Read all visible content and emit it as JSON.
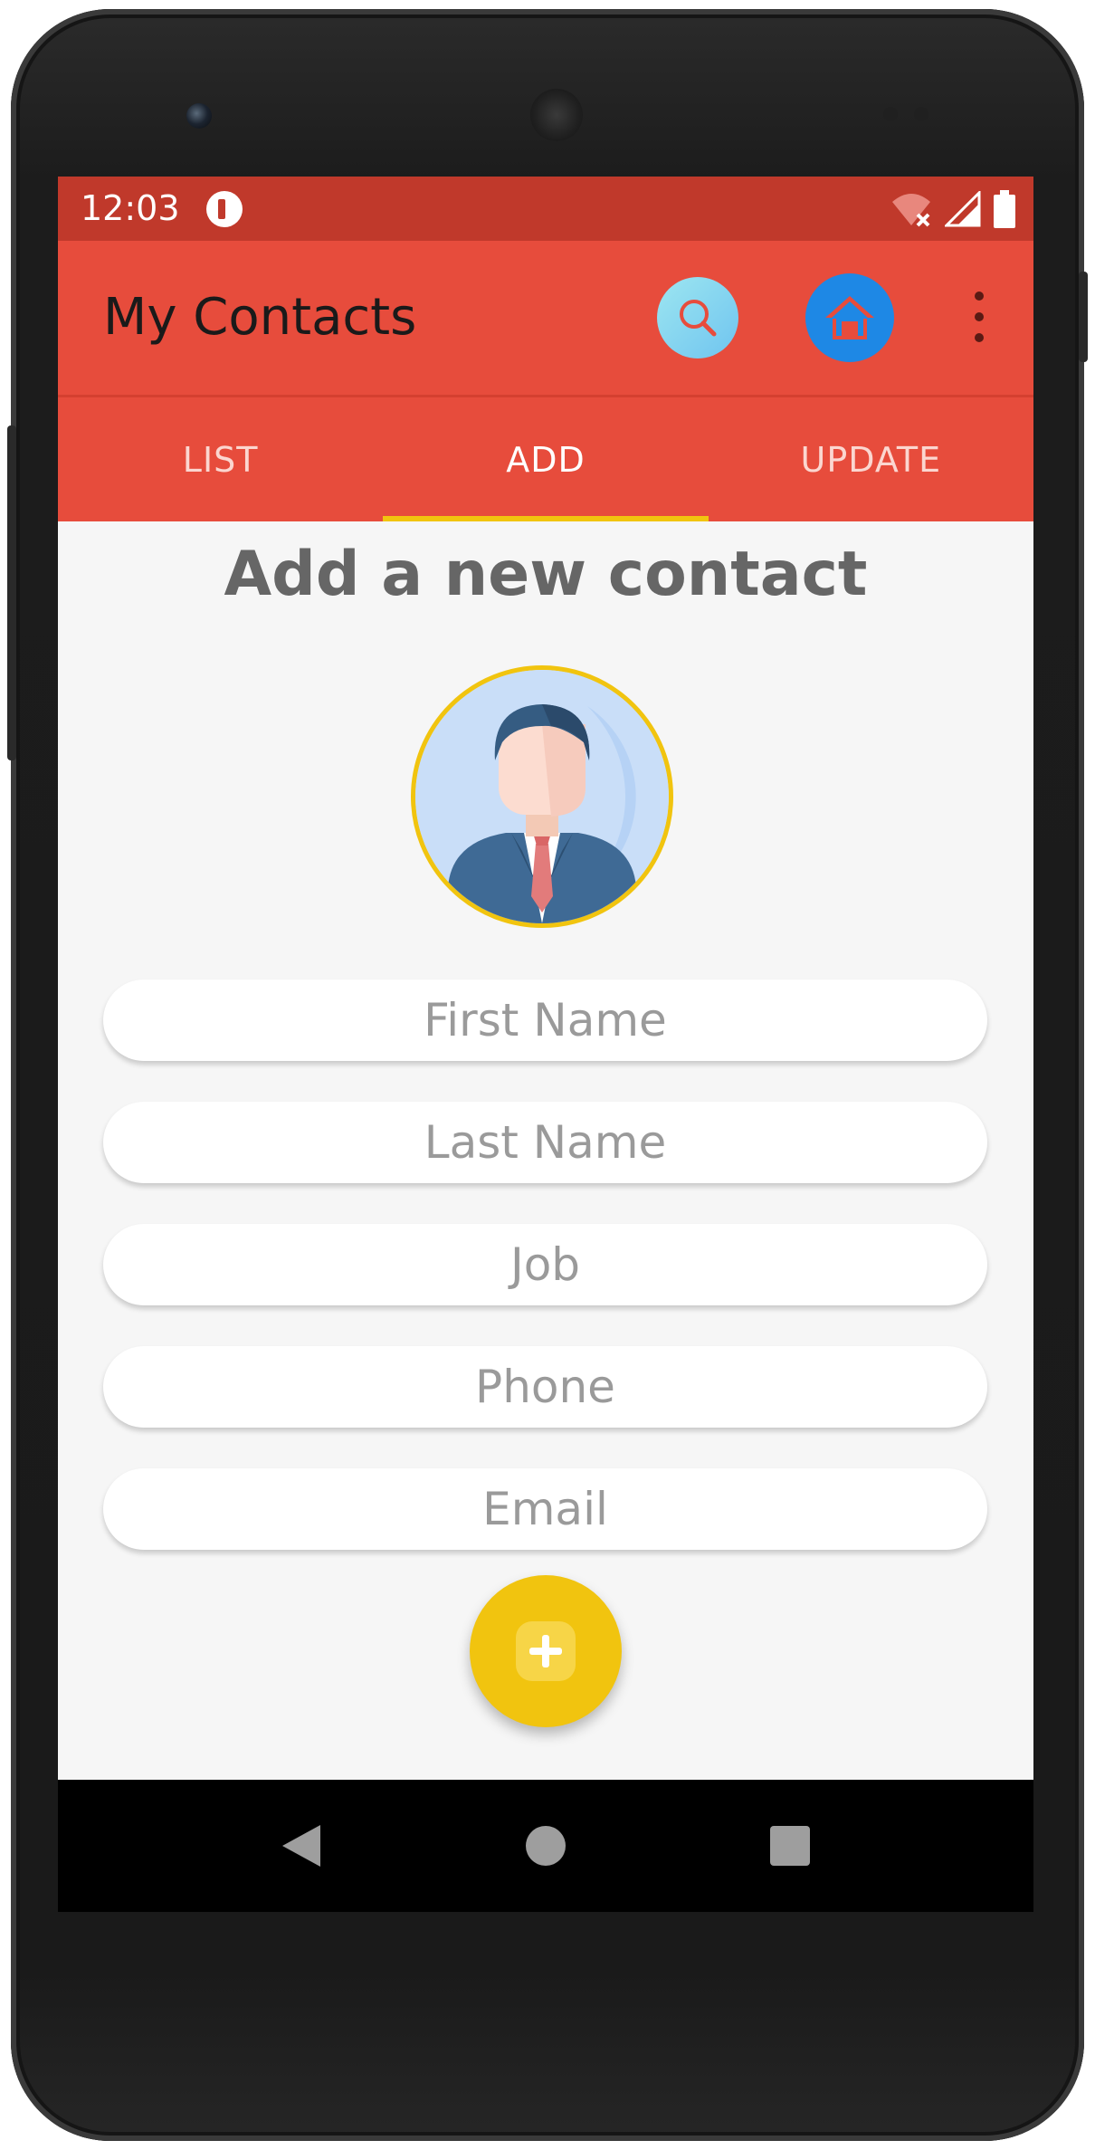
{
  "status_bar": {
    "time": "12:03"
  },
  "app_bar": {
    "title": "My Contacts",
    "actions": [
      "search-icon",
      "home-icon",
      "more-vert-icon"
    ]
  },
  "tabs": [
    {
      "label": "LIST",
      "active": false
    },
    {
      "label": "ADD",
      "active": true
    },
    {
      "label": "UPDATE",
      "active": false
    }
  ],
  "form": {
    "heading": "Add a new contact",
    "fields": {
      "first_name": "First Name",
      "last_name": "Last Name",
      "job": "Job",
      "phone": "Phone",
      "email": "Email"
    },
    "submit_icon": "plus-icon"
  },
  "colors": {
    "status_bar": "#c0392b",
    "app_bar": "#e74c3c",
    "tab_indicator": "#f1c40f",
    "fab": "#f1c40f",
    "home_button": "#1e88e5"
  }
}
